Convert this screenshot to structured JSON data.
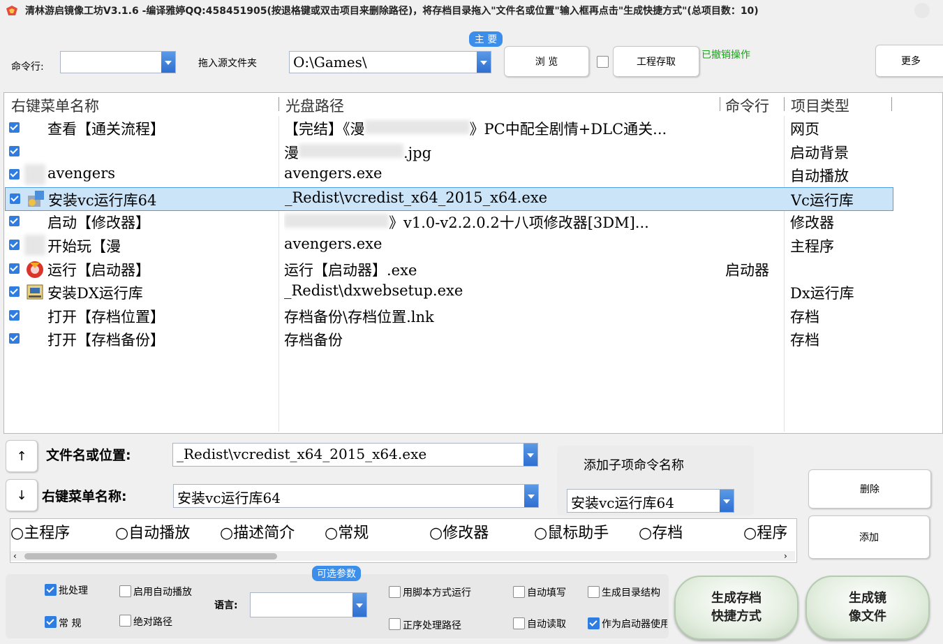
{
  "window": {
    "title": "清林游启镜像工坊V3.1.6 -编译雅婷QQ:458451905(按退格键或双击项目来删除路径)，将存档目录拖入\"文件名或位置\"输入框再点击\"生成快捷方式\"(总项目数：10)"
  },
  "toolbar": {
    "command_label": "命令行:",
    "command_value": "",
    "drag_label": "拖入源文件夹",
    "source_value": "O:\\Games\\",
    "main_tab": "主 要",
    "browse": "浏 览",
    "project_save": "工程存取",
    "undo_status": "已撤销操作",
    "more": "更多"
  },
  "list": {
    "columns": [
      "右键菜单名称",
      "光盘路径",
      "命令行",
      "项目类型"
    ],
    "rows": [
      {
        "name": "查看【通关流程】",
        "path": "【完结】《漫",
        "path_tail": "》PC中配全剧情+DLC通关...",
        "cmd": "",
        "type": "网页",
        "icon": "none",
        "selected": false
      },
      {
        "name": "",
        "path": "漫",
        "path_tail": ".jpg",
        "cmd": "",
        "type": "启动背景",
        "icon": "none",
        "selected": false
      },
      {
        "name": "avengers",
        "path": "avengers.exe",
        "path_tail": "",
        "cmd": "",
        "type": "自动播放",
        "icon": "blank-icon",
        "selected": false
      },
      {
        "name": "安装vc运行库64",
        "path": "_Redist\\vcredist_x64_2015_x64.exe",
        "path_tail": "",
        "cmd": "",
        "type": "Vc运行库",
        "icon": "installer-icon",
        "selected": true
      },
      {
        "name": "启动【修改器】",
        "path": "",
        "path_tail": "》v1.0-v2.2.0.2十八项修改器[3DM]...",
        "cmd": "",
        "type": "修改器",
        "icon": "none",
        "selected": false
      },
      {
        "name": "开始玩【漫",
        "path": "avengers.exe",
        "path_tail": "",
        "cmd": "",
        "type": "主程序",
        "icon": "blank-icon",
        "selected": false
      },
      {
        "name": "运行【启动器】",
        "path": "运行【启动器】.exe",
        "path_tail": "",
        "cmd": "启动器",
        "type": "",
        "icon": "launcher-icon",
        "selected": false
      },
      {
        "name": "安装DX运行库",
        "path": "_Redist\\dxwebsetup.exe",
        "path_tail": "",
        "cmd": "",
        "type": "Dx运行库",
        "icon": "setup-icon",
        "selected": false
      },
      {
        "name": "打开【存档位置】",
        "path": "存档备份\\存档位置.lnk",
        "path_tail": "",
        "cmd": "",
        "type": "存档",
        "icon": "none",
        "selected": false
      },
      {
        "name": "打开【存档备份】",
        "path": "存档备份",
        "path_tail": "",
        "cmd": "",
        "type": "存档",
        "icon": "none",
        "selected": false
      }
    ]
  },
  "editor": {
    "up": "↑",
    "down": "↓",
    "file_label": "文件名或位置:",
    "file_value": "_Redist\\vcredist_x64_2015_x64.exe",
    "menu_label": "右键菜单名称:",
    "menu_value": "安装vc运行库64",
    "sub_label": "添加子项命令名称",
    "sub_value": "安装vc运行库64",
    "delete": "删除",
    "add": "添加"
  },
  "types": [
    "○主程序",
    "○自动播放",
    "○描述简介",
    "○常规",
    "○修改器",
    "○鼠标助手",
    "○存档",
    "○程序"
  ],
  "options": {
    "section_title": "可选参数",
    "batch": {
      "label": "批处理",
      "checked": true
    },
    "normal": {
      "label": "常 规",
      "checked": true
    },
    "autoplay": {
      "label": "启用自动播放",
      "checked": false
    },
    "absolute": {
      "label": "绝对路径",
      "checked": false
    },
    "language_label": "语言:",
    "language_value": "",
    "script_mode": {
      "label": "用脚本方式运行",
      "checked": false
    },
    "reverse": {
      "label": "正序处理路径",
      "checked": false
    },
    "autofill": {
      "label": "自动填写",
      "checked": false
    },
    "autoread": {
      "label": "自动读取",
      "checked": false
    },
    "gen_dir": {
      "label": "生成目录结构",
      "checked": false
    },
    "as_launcher": {
      "label": "作为启动器使用",
      "checked": true
    }
  },
  "actions": {
    "gen_shortcut_line1": "生成存档",
    "gen_shortcut_line2": "快捷方式",
    "gen_image_line1": "生成镜",
    "gen_image_line2": "像文件"
  }
}
